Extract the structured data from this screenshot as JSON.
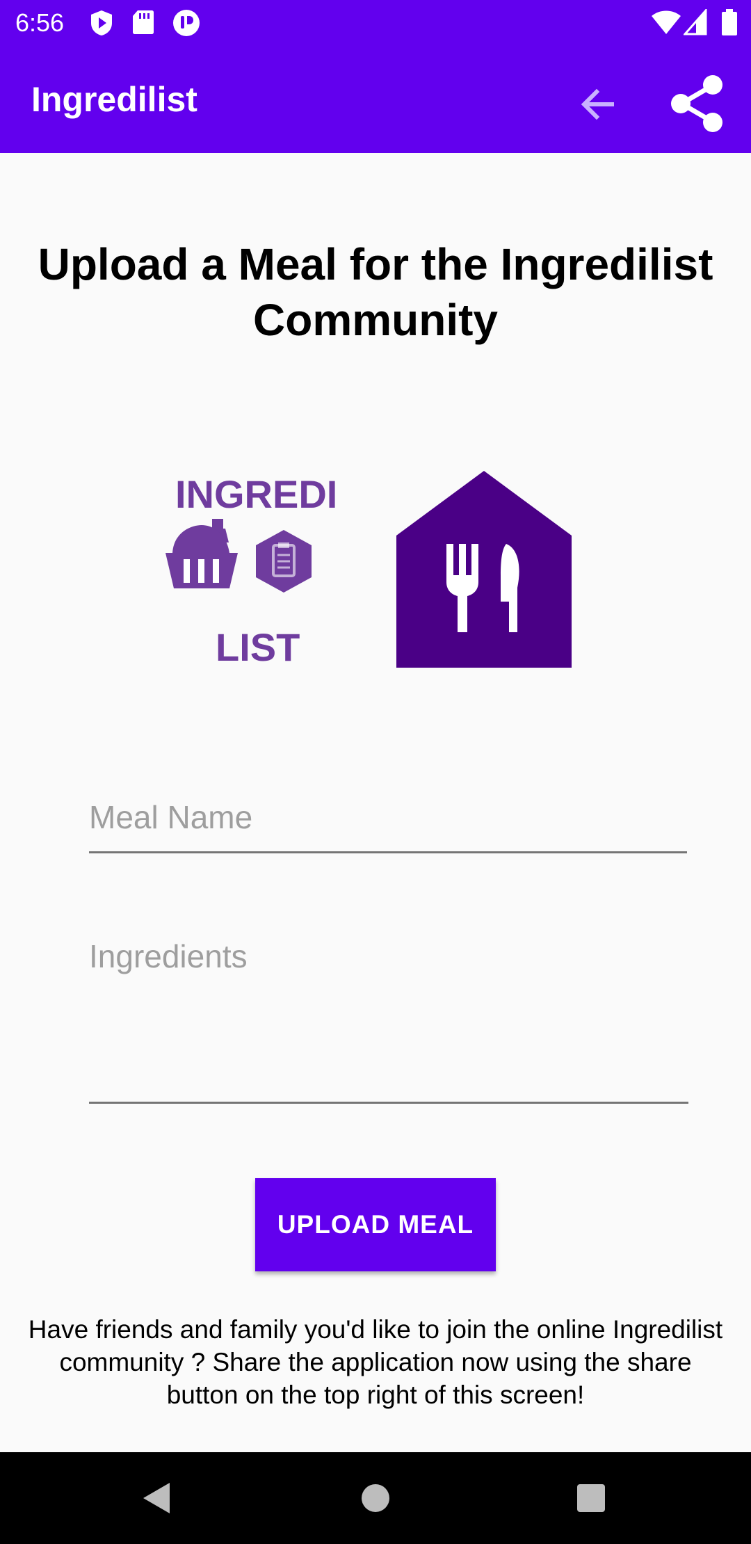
{
  "status_bar": {
    "time": "6:56"
  },
  "app_bar": {
    "title": "Ingredilist"
  },
  "heading": "Upload a Meal for the Ingredilist Community",
  "logo": {
    "top_text": "INGREDI",
    "bottom_text": "LIST"
  },
  "form": {
    "meal_name_placeholder": "Meal Name",
    "ingredients_placeholder": "Ingredients",
    "upload_label": "UPLOAD MEAL"
  },
  "footer_message": "Have friends and family you'd like to join the online Ingredilist community ? Share the application now using the share button on the top right of this screen!",
  "colors": {
    "primary": "#6200ee",
    "logo_purple": "#6f3c9e",
    "meal_icon": "#4a0086"
  },
  "icons": [
    "play-protect-icon",
    "sd-card-icon",
    "notification-icon",
    "wifi-icon",
    "signal-icon",
    "battery-icon",
    "back-arrow-icon",
    "share-icon",
    "nav-back-icon",
    "nav-home-icon",
    "nav-recents-icon"
  ]
}
